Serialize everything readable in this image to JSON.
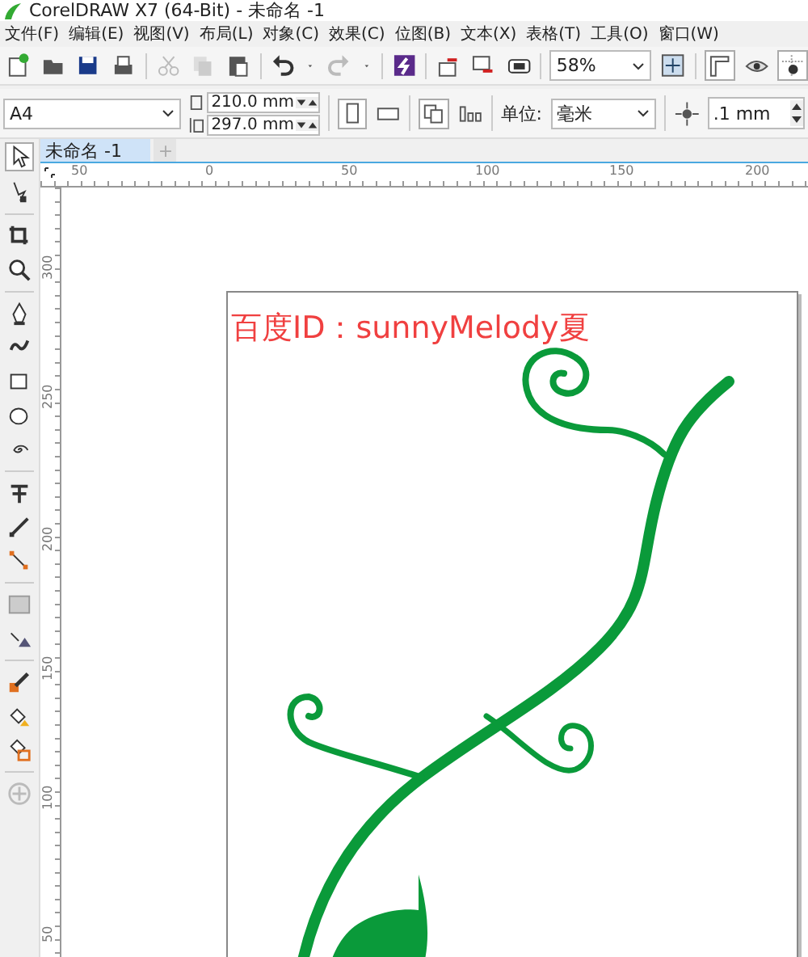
{
  "window": {
    "title": "CorelDRAW X7 (64-Bit) - 未命名 -1"
  },
  "menu": [
    "文件(F)",
    "编辑(E)",
    "视图(V)",
    "布局(L)",
    "对象(C)",
    "效果(C)",
    "位图(B)",
    "文本(X)",
    "表格(T)",
    "工具(O)",
    "窗口(W)"
  ],
  "toolbar": {
    "zoom": "58%"
  },
  "property_bar": {
    "page_size": "A4",
    "width": "210.0 mm",
    "height": "297.0 mm",
    "units_label": "单位:",
    "units": "毫米",
    "nudge": ".1 mm"
  },
  "tabs": [
    {
      "label": "未命名 -1",
      "selected": true
    }
  ],
  "add_tab": "+",
  "rulers": {
    "horizontal": [
      "50",
      "0",
      "50",
      "100",
      "150",
      "200"
    ],
    "vertical": [
      "300",
      "250",
      "200",
      "150",
      "100",
      "50"
    ]
  },
  "canvas": {
    "text": "百度ID：sunnyMelody夏"
  }
}
